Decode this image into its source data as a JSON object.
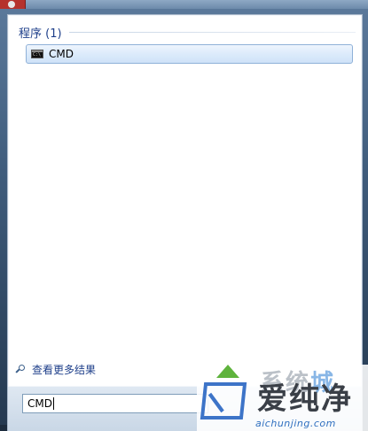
{
  "start_menu": {
    "group_title": "程序 (1)",
    "results": [
      {
        "label": "CMD",
        "icon": "cmd-icon"
      }
    ],
    "see_more_label": "查看更多结果",
    "see_more_icon": "search-icon",
    "search": {
      "value": "CMD"
    }
  },
  "watermark": {
    "title": "爱纯净",
    "url": "aichunjing.com",
    "top_text": "系统",
    "top_text_accent": "城"
  },
  "colors": {
    "header_text": "#1e3f8a",
    "selection_border": "#8fb1d8",
    "watermark_blue": "#3a86d6",
    "watermark_green": "#5fb33d"
  }
}
